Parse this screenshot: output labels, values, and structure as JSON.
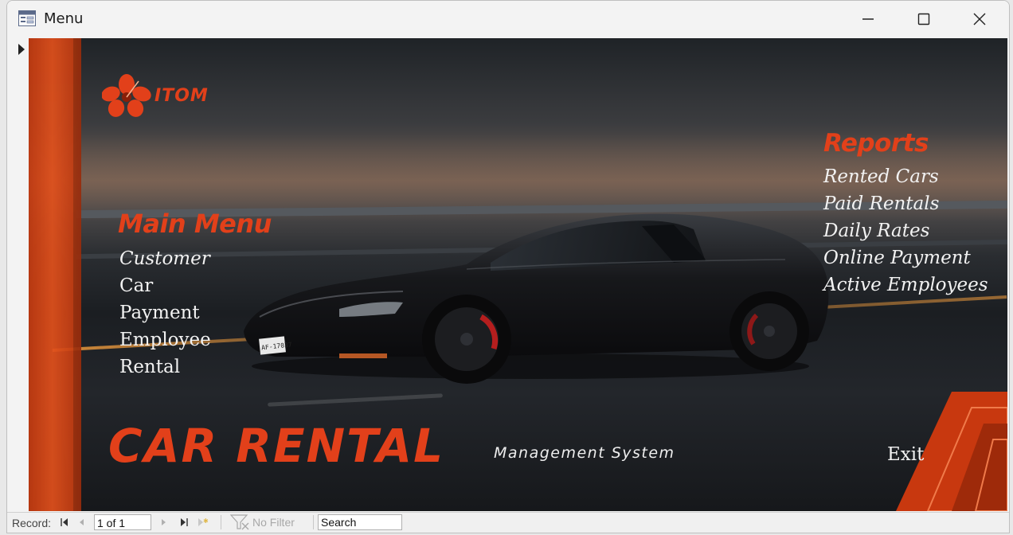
{
  "window": {
    "title": "Menu"
  },
  "logo": {
    "text": "ITOM"
  },
  "main_menu": {
    "heading": "Main Menu",
    "items": [
      "Customer",
      "Car",
      "Payment",
      "Employee",
      "Rental"
    ]
  },
  "reports": {
    "heading": "Reports",
    "items": [
      "Rented Cars",
      "Paid Rentals",
      "Daily Rates",
      "Online Payment",
      "Active Employees"
    ]
  },
  "brand": {
    "title": "CAR RENTAL",
    "subtitle": "Management System"
  },
  "exit_label": "Exit",
  "car": {
    "plate": "AF-17037"
  },
  "record_nav": {
    "label": "Record:",
    "position": "1 of 1",
    "filter_label": "No Filter",
    "search_value": "Search"
  },
  "colors": {
    "accent": "#e2401a",
    "menu_text": "#f2f2f2"
  }
}
